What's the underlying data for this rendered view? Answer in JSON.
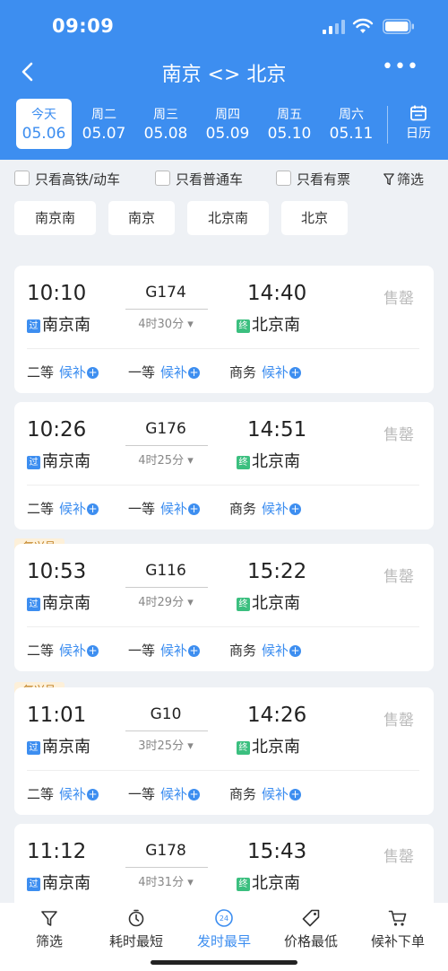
{
  "status": {
    "time": "09:09"
  },
  "nav": {
    "title": "南京 <> 北京",
    "more": "•••"
  },
  "dates": [
    {
      "week": "今天",
      "date": "05.06",
      "selected": true
    },
    {
      "week": "周二",
      "date": "05.07"
    },
    {
      "week": "周三",
      "date": "05.08"
    },
    {
      "week": "周四",
      "date": "05.09"
    },
    {
      "week": "周五",
      "date": "05.10"
    },
    {
      "week": "周六",
      "date": "05.11"
    }
  ],
  "calendar_label": "日历",
  "filters": {
    "high_speed": "只看高铁/动车",
    "regular": "只看普通车",
    "available": "只看有票",
    "filter": "筛选"
  },
  "stations": [
    "南京南",
    "南京",
    "北京南",
    "北京"
  ],
  "trains": [
    {
      "badge": "",
      "dep_time": "10:10",
      "train_no": "G174",
      "duration": "4时30分",
      "arr_time": "14:40",
      "dep_station": "南京南",
      "arr_station": "北京南",
      "status": "售罄",
      "pass_tag": "过",
      "end_tag": "终"
    },
    {
      "badge": "",
      "dep_time": "10:26",
      "train_no": "G176",
      "duration": "4时25分",
      "arr_time": "14:51",
      "dep_station": "南京南",
      "arr_station": "北京南",
      "status": "售罄",
      "pass_tag": "过",
      "end_tag": "终"
    },
    {
      "badge": "复兴号",
      "dep_time": "10:53",
      "train_no": "G116",
      "duration": "4时29分",
      "arr_time": "15:22",
      "dep_station": "南京南",
      "arr_station": "北京南",
      "status": "售罄",
      "pass_tag": "过",
      "end_tag": "终"
    },
    {
      "badge": "复兴号",
      "dep_time": "11:01",
      "train_no": "G10",
      "duration": "3时25分",
      "arr_time": "14:26",
      "dep_station": "南京南",
      "arr_station": "北京南",
      "status": "售罄",
      "pass_tag": "过",
      "end_tag": "终"
    },
    {
      "badge": "",
      "dep_time": "11:12",
      "train_no": "G178",
      "duration": "4时31分",
      "arr_time": "15:43",
      "dep_station": "南京南",
      "arr_station": "北京南",
      "status": "售罄",
      "pass_tag": "过",
      "end_tag": "终"
    }
  ],
  "seats": {
    "second": "二等",
    "first": "一等",
    "business": "商务",
    "waitlist": "候补"
  },
  "bottom_tabs": [
    {
      "label": "筛选",
      "icon": "filter-icon"
    },
    {
      "label": "耗时最短",
      "icon": "timer-icon"
    },
    {
      "label": "发时最早",
      "icon": "clock-24-icon",
      "active": true
    },
    {
      "label": "价格最低",
      "icon": "price-tag-icon"
    },
    {
      "label": "候补下单",
      "icon": "cart-icon"
    }
  ],
  "colors": {
    "brand": "#3d8ef0",
    "badge_bg": "#fdf0d9",
    "badge_text": "#c08020",
    "end_tag": "#3bbf7f"
  }
}
